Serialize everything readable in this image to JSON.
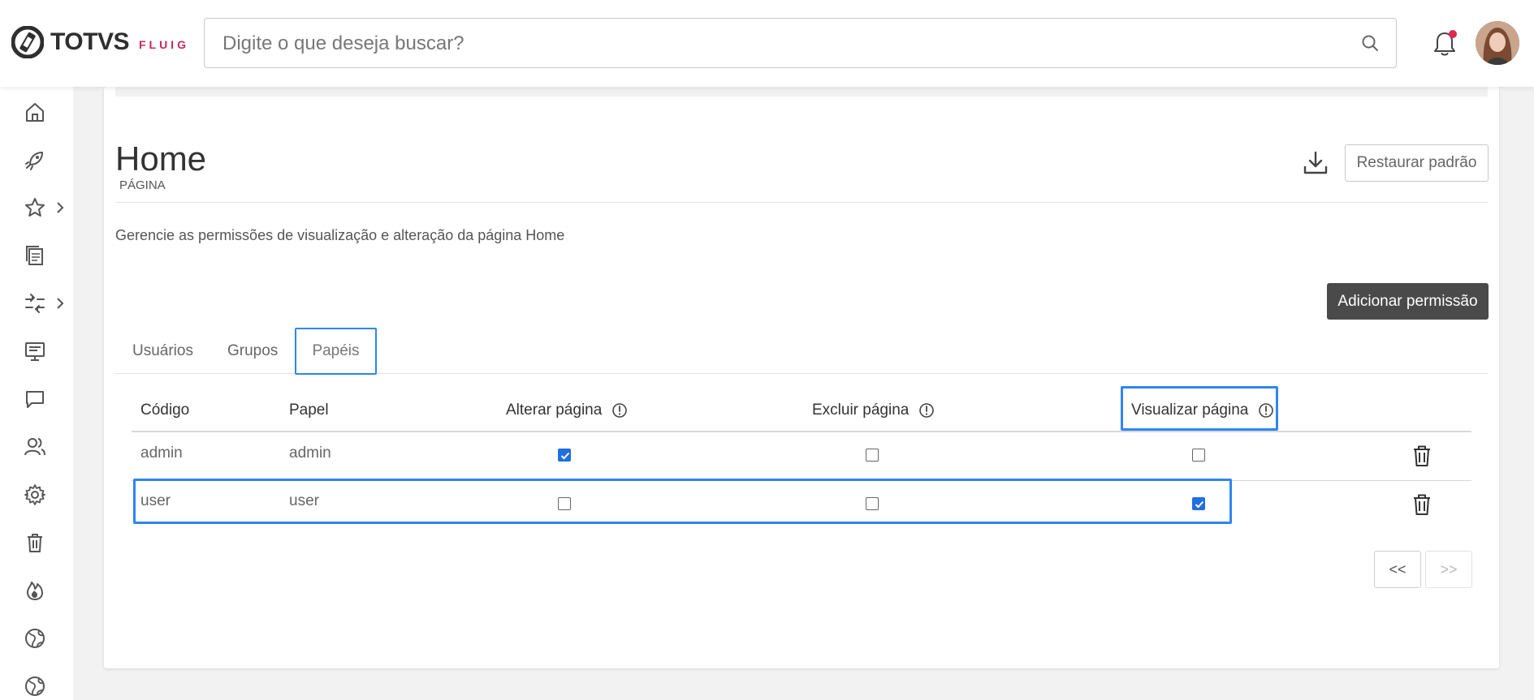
{
  "brand": {
    "name": "TOTVS",
    "product": "FLUIG",
    "color": "#c8285e"
  },
  "search": {
    "placeholder": "Digite o que deseja buscar?",
    "value": ""
  },
  "header": {
    "notification_dot": true,
    "accent": "#e0284f"
  },
  "sidebar": {
    "items": [
      {
        "icon": "home-icon"
      },
      {
        "icon": "rocket-icon"
      },
      {
        "icon": "star-icon",
        "has_submenu": true
      },
      {
        "icon": "documents-icon"
      },
      {
        "icon": "workflow-icon",
        "has_submenu": true
      },
      {
        "icon": "presentation-icon"
      },
      {
        "icon": "chat-icon"
      },
      {
        "icon": "users-icon"
      },
      {
        "icon": "gear-icon"
      },
      {
        "icon": "trash-icon"
      },
      {
        "icon": "fire-icon"
      },
      {
        "icon": "globe-icon"
      },
      {
        "icon": "globe-icon"
      }
    ]
  },
  "page": {
    "title": "Home",
    "subtitle": "PÁGINA",
    "description": "Gerencie as permissões de visualização e alteração da página Home",
    "restore_label": "Restaurar padrão",
    "add_label": "Adicionar permissão"
  },
  "tabs": [
    {
      "label": "Usuários",
      "active": false
    },
    {
      "label": "Grupos",
      "active": false
    },
    {
      "label": "Papéis",
      "active": true
    }
  ],
  "table": {
    "columns": [
      "Código",
      "Papel",
      "Alterar página",
      "Excluir página",
      "Visualizar página"
    ],
    "rows": [
      {
        "code": "admin",
        "role": "admin",
        "alterar": true,
        "excluir": false,
        "visualizar": false
      },
      {
        "code": "user",
        "role": "user",
        "alterar": false,
        "excluir": false,
        "visualizar": true
      }
    ]
  },
  "pagination": {
    "prev_label": "<<",
    "next_label": ">>"
  },
  "colors": {
    "highlight": "#2e86f2",
    "checkbox": "#1f6fe0",
    "primary_button": "#4a4a4a"
  }
}
